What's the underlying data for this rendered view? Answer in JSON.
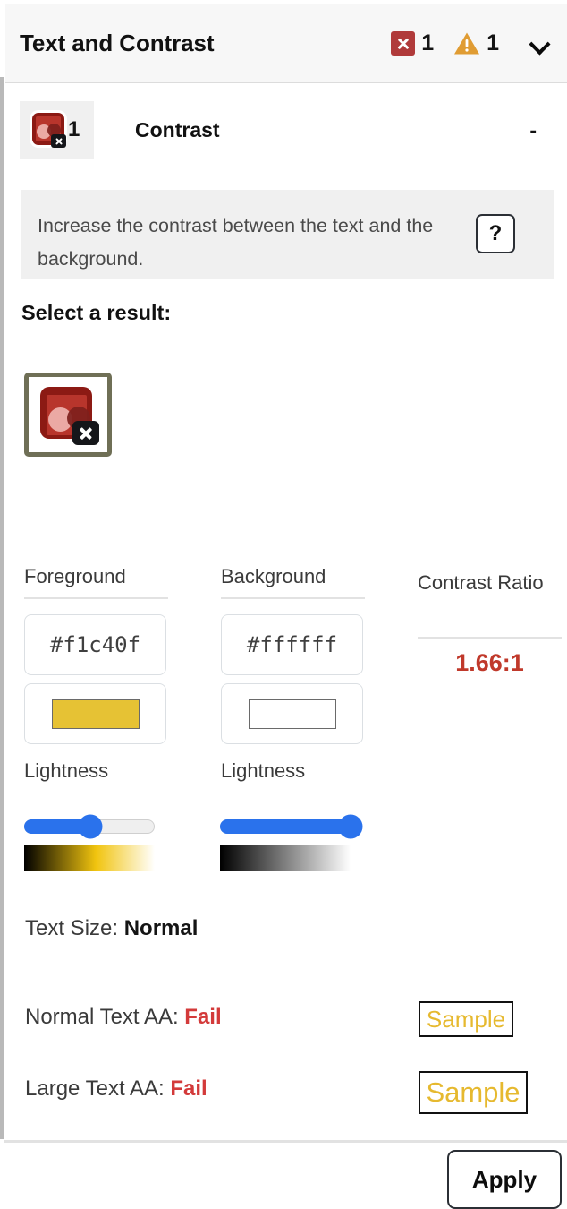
{
  "header": {
    "title": "Text and Contrast",
    "error_icon": "error-x-icon",
    "error_count": "1",
    "warning_icon": "warning-triangle-icon",
    "warning_count": "1",
    "collapse_icon": "chevron-down-icon"
  },
  "result": {
    "icon": "contrast-fail-icon",
    "count": "1",
    "label": "Contrast",
    "value": "-"
  },
  "description": {
    "text": "Increase the contrast between the text and the background.",
    "help_label": "?"
  },
  "select": {
    "title": "Select a result:",
    "swatch_icon": "contrast-fail-icon"
  },
  "foreground": {
    "heading": "Foreground",
    "hex": "#f1c40f",
    "swatch_color": "#e6c234",
    "lightness_label": "Lightness",
    "lightness_percent": 51,
    "gradient_start": "#000000",
    "gradient_mid": "#f1c40f",
    "gradient_end": "#ffffff"
  },
  "background": {
    "heading": "Background",
    "hex": "#ffffff",
    "swatch_color": "#ffffff",
    "lightness_label": "Lightness",
    "lightness_percent": 100,
    "gradient_start": "#000000",
    "gradient_end": "#ffffff"
  },
  "ratio": {
    "heading": "Contrast Ratio",
    "value": "1.66:1",
    "value_color": "#c0392b"
  },
  "text_size": {
    "label": "Text Size:",
    "value": "Normal"
  },
  "results": {
    "normal_label": "Normal Text AA:",
    "normal_status": "Fail",
    "normal_sample": "Sample",
    "large_label": "Large Text AA:",
    "large_status": "Fail",
    "large_sample": "Sample",
    "sample_color": "#e6b92f"
  },
  "footer": {
    "apply_label": "Apply"
  }
}
